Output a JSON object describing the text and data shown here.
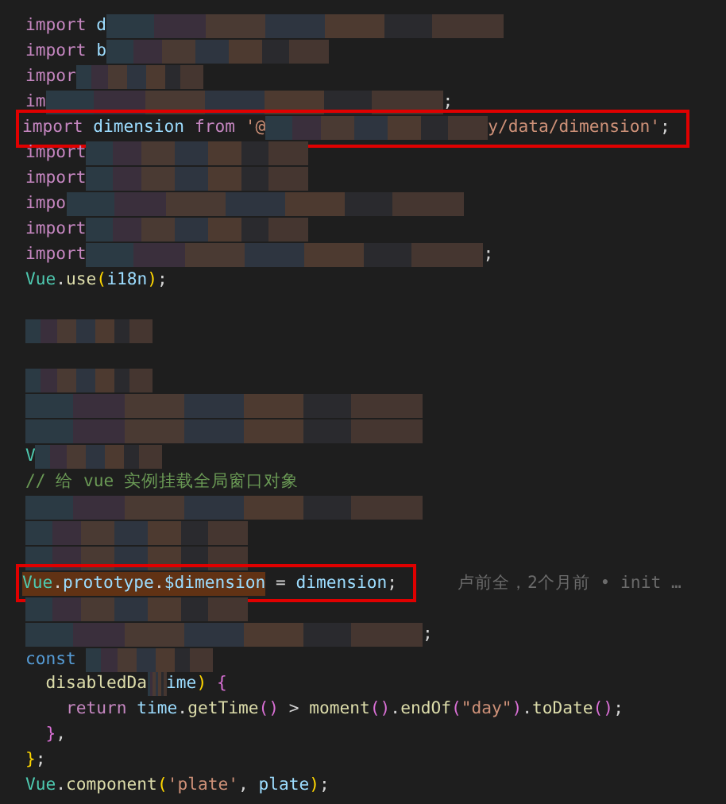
{
  "editor": {
    "lines": [
      {
        "highlighted": false,
        "tokens": [
          {
            "kind": "keyword",
            "text": "import"
          },
          {
            "kind": "ident",
            "text": " d"
          },
          {
            "kind": "redacted-long"
          }
        ]
      },
      {
        "highlighted": false,
        "tokens": [
          {
            "kind": "keyword",
            "text": "import"
          },
          {
            "kind": "ident",
            "text": " b"
          },
          {
            "kind": "redacted-medium"
          }
        ]
      },
      {
        "highlighted": false,
        "tokens": [
          {
            "kind": "keyword",
            "text": "impor"
          },
          {
            "kind": "redacted-short"
          }
        ]
      },
      {
        "highlighted": false,
        "tokens": [
          {
            "kind": "keyword",
            "text": "im"
          },
          {
            "kind": "redacted-long"
          },
          {
            "kind": "punct",
            "text": ";"
          }
        ]
      },
      {
        "highlighted": true,
        "tokens": [
          {
            "kind": "keyword",
            "text": "import"
          },
          {
            "kind": "ident",
            "text": " dimension "
          },
          {
            "kind": "keyword",
            "text": "from"
          },
          {
            "kind": "string",
            "text": " '@"
          },
          {
            "kind": "redacted-medium"
          },
          {
            "kind": "string",
            "text": "y/data/dimension'"
          },
          {
            "kind": "punct",
            "text": ";"
          }
        ]
      },
      {
        "highlighted": false,
        "tokens": [
          {
            "kind": "keyword",
            "text": "import"
          },
          {
            "kind": "redacted-medium"
          }
        ]
      },
      {
        "highlighted": false,
        "tokens": [
          {
            "kind": "keyword",
            "text": "import"
          },
          {
            "kind": "redacted-medium"
          }
        ]
      },
      {
        "highlighted": false,
        "tokens": [
          {
            "kind": "keyword",
            "text": "impo"
          },
          {
            "kind": "redacted-long"
          }
        ]
      },
      {
        "highlighted": false,
        "tokens": [
          {
            "kind": "keyword",
            "text": "import"
          },
          {
            "kind": "redacted-medium"
          }
        ]
      },
      {
        "highlighted": false,
        "tokens": [
          {
            "kind": "keyword",
            "text": "import"
          },
          {
            "kind": "redacted-long"
          },
          {
            "kind": "punct",
            "text": ";"
          }
        ]
      },
      {
        "highlighted": false,
        "tokens": [
          {
            "kind": "class",
            "text": "Vue"
          },
          {
            "kind": "punct",
            "text": "."
          },
          {
            "kind": "fn",
            "text": "use"
          },
          {
            "kind": "bracket",
            "text": "("
          },
          {
            "kind": "ident",
            "text": "i18n"
          },
          {
            "kind": "bracket",
            "text": ")"
          },
          {
            "kind": "punct",
            "text": ";"
          }
        ]
      },
      {
        "highlighted": false
      },
      {
        "highlighted": false,
        "tokens": [
          {
            "kind": "redacted-short"
          }
        ]
      },
      {
        "highlighted": false
      },
      {
        "highlighted": false,
        "tokens": [
          {
            "kind": "redacted-short"
          }
        ]
      },
      {
        "highlighted": false,
        "tokens": [
          {
            "kind": "redacted-long"
          }
        ]
      },
      {
        "highlighted": false,
        "tokens": [
          {
            "kind": "redacted-long"
          }
        ]
      },
      {
        "highlighted": false,
        "tokens": [
          {
            "kind": "class",
            "text": "V"
          },
          {
            "kind": "redacted-short"
          }
        ]
      },
      {
        "highlighted": false,
        "tokens": [
          {
            "kind": "comment",
            "text": "// 给 vue 实例挂载全局窗口对象"
          }
        ]
      },
      {
        "highlighted": false,
        "tokens": [
          {
            "kind": "redacted-long"
          }
        ]
      },
      {
        "highlighted": false,
        "tokens": [
          {
            "kind": "redacted-medium"
          }
        ]
      },
      {
        "highlighted": false,
        "tokens": [
          {
            "kind": "redacted-medium"
          }
        ]
      },
      {
        "highlighted": true,
        "blame": "卢前全，2个月前 • init …",
        "tokens": [
          {
            "kind": "class",
            "text": "Vue",
            "match": true
          },
          {
            "kind": "punct",
            "text": ".",
            "match": true
          },
          {
            "kind": "ident",
            "text": "prototype",
            "match": true
          },
          {
            "kind": "punct",
            "text": ".",
            "match": true
          },
          {
            "kind": "ident",
            "text": "$dimension",
            "match": true
          },
          {
            "kind": "punct",
            "text": " = "
          },
          {
            "kind": "ident",
            "text": "dimension"
          },
          {
            "kind": "punct",
            "text": ";"
          }
        ]
      },
      {
        "highlighted": false,
        "tokens": [
          {
            "kind": "redacted-medium"
          }
        ]
      },
      {
        "highlighted": false,
        "tokens": [
          {
            "kind": "redacted-long"
          },
          {
            "kind": "punct",
            "text": ";"
          }
        ]
      },
      {
        "highlighted": false,
        "tokens": [
          {
            "kind": "storage",
            "text": "const "
          },
          {
            "kind": "redacted-short"
          }
        ]
      },
      {
        "highlighted": false,
        "tokens": [
          {
            "kind": "fn",
            "text": "  disabledDa"
          },
          {
            "kind": "redacted-tiny"
          },
          {
            "kind": "ident",
            "text": "ime"
          },
          {
            "kind": "bracket",
            "text": ")"
          },
          {
            "kind": "bracket2",
            "text": " {"
          }
        ]
      },
      {
        "highlighted": false,
        "tokens": [
          {
            "kind": "keyword",
            "text": "    return"
          },
          {
            "kind": "ident",
            "text": " time"
          },
          {
            "kind": "punct",
            "text": "."
          },
          {
            "kind": "fn",
            "text": "getTime"
          },
          {
            "kind": "bracket2",
            "text": "()"
          },
          {
            "kind": "punct",
            "text": " > "
          },
          {
            "kind": "fn",
            "text": "moment"
          },
          {
            "kind": "bracket2",
            "text": "()"
          },
          {
            "kind": "punct",
            "text": "."
          },
          {
            "kind": "fn",
            "text": "endOf"
          },
          {
            "kind": "bracket2",
            "text": "("
          },
          {
            "kind": "string",
            "text": "\"day\""
          },
          {
            "kind": "bracket2",
            "text": ")"
          },
          {
            "kind": "punct",
            "text": "."
          },
          {
            "kind": "fn",
            "text": "toDate"
          },
          {
            "kind": "bracket2",
            "text": "()"
          },
          {
            "kind": "punct",
            "text": ";"
          }
        ]
      },
      {
        "highlighted": false,
        "tokens": [
          {
            "kind": "bracket2",
            "text": "  }"
          },
          {
            "kind": "punct",
            "text": ","
          }
        ]
      },
      {
        "highlighted": false,
        "tokens": [
          {
            "kind": "bracket",
            "text": "}"
          },
          {
            "kind": "punct",
            "text": ";"
          }
        ]
      },
      {
        "highlighted": false,
        "tokens": [
          {
            "kind": "class",
            "text": "Vue"
          },
          {
            "kind": "punct",
            "text": "."
          },
          {
            "kind": "fn",
            "text": "component"
          },
          {
            "kind": "bracket",
            "text": "("
          },
          {
            "kind": "string",
            "text": "'plate'"
          },
          {
            "kind": "punct",
            "text": ", "
          },
          {
            "kind": "ident",
            "text": "plate"
          },
          {
            "kind": "bracket",
            "text": ")"
          },
          {
            "kind": "punct",
            "text": ";"
          }
        ]
      }
    ]
  }
}
